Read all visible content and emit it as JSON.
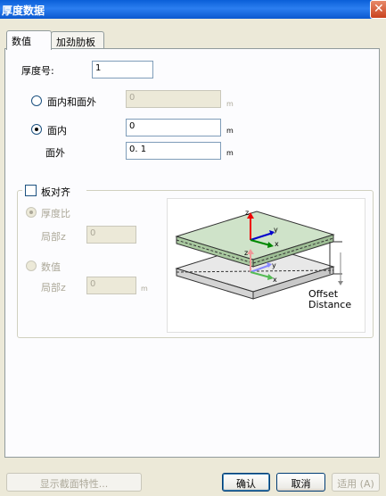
{
  "window": {
    "title": "厚度数据"
  },
  "tabs": [
    {
      "label": "数值"
    },
    {
      "label": "加劲肋板"
    }
  ],
  "thickness_no": {
    "label": "厚度号:",
    "value": "1"
  },
  "option_in_out": {
    "label": "面内和面外",
    "value": "0",
    "unit": "m"
  },
  "option_in": {
    "label": "面内",
    "value": "0",
    "unit": "m"
  },
  "out_plane": {
    "label": "面外",
    "value": "0. 1",
    "unit": "m"
  },
  "plate_align": {
    "checkbox_label": "板对齐",
    "ratio": {
      "label": "厚度比",
      "local_label": "局部z",
      "value": "0"
    },
    "numeric": {
      "label": "数值",
      "local_label": "局部z",
      "value": "0",
      "unit": "m"
    }
  },
  "diagram": {
    "label_line1": "Offset",
    "label_line2": "Distance",
    "axes": [
      "z",
      "y",
      "x"
    ]
  },
  "buttons": {
    "section_props": "显示截面特性...",
    "ok": "确认",
    "cancel": "取消",
    "apply": "适用 (A)"
  },
  "colors": {
    "title_bar": "#0b58cf",
    "panel": "#ece9d8",
    "plate_top": "#cfe3c9",
    "plate_bottom": "#e8e8e8"
  }
}
